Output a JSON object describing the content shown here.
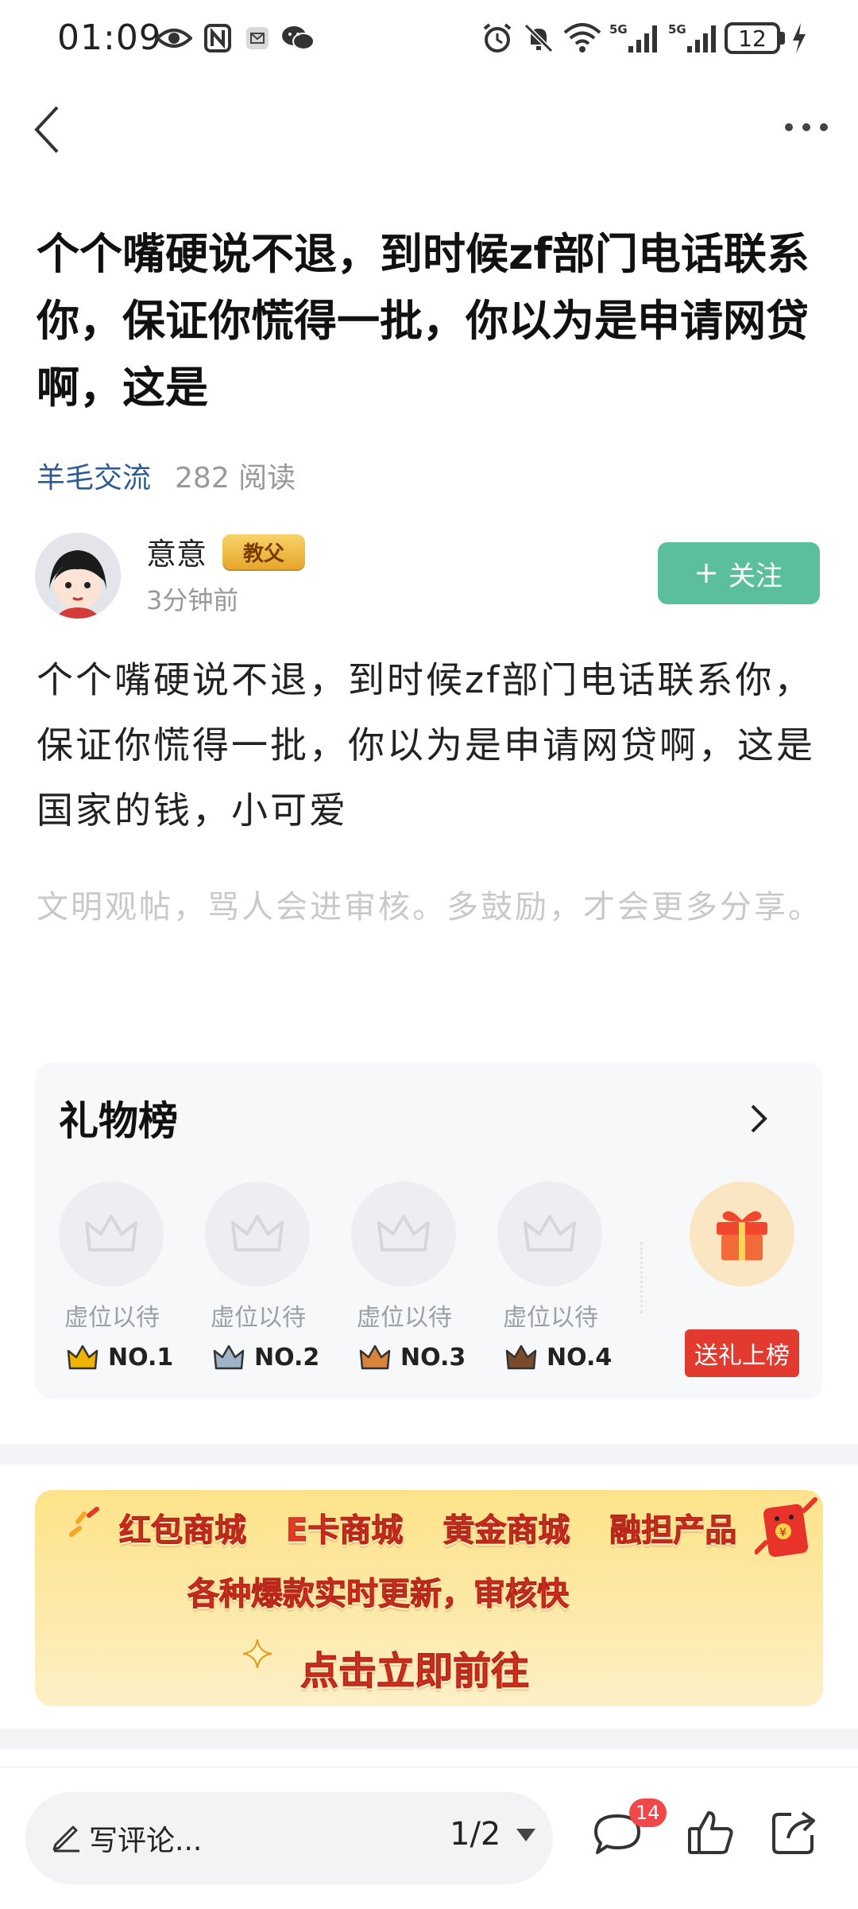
{
  "status_bar": {
    "time": "01:09",
    "battery": "12",
    "icons": [
      "eye-icon",
      "nfc-icon",
      "mail-icon",
      "wechat-icon",
      "alarm-icon",
      "mute-icon",
      "wifi-icon",
      "signal-5g-icon",
      "signal-5g-icon",
      "battery-icon",
      "charging-icon"
    ],
    "network1": "5G",
    "network2": "5G"
  },
  "post": {
    "title": "个个嘴硬说不退，到时候zf部门电话联系你，保证你慌得一批，你以为是申请网贷啊，这是",
    "category": "羊毛交流",
    "read_count": "282 阅读",
    "author": {
      "name": "意意",
      "badge": "教父",
      "time": "3分钟前"
    },
    "follow_label": "关注",
    "body": "个个嘴硬说不退，到时候zf部门电话联系你，保证你慌得一批，你以为是申请网贷啊，这是国家的钱，小可爱",
    "comment_hint": "文明观帖，骂人会进审核。多鼓励，才会更多分享。"
  },
  "gift_board": {
    "title": "礼物榜",
    "slots": [
      {
        "label": "虚位以待",
        "rank": "NO.1",
        "crown_color": "#f0b400"
      },
      {
        "label": "虚位以待",
        "rank": "NO.2",
        "crown_color": "#9fb4c8"
      },
      {
        "label": "虚位以待",
        "rank": "NO.3",
        "crown_color": "#d9843a"
      },
      {
        "label": "虚位以待",
        "rank": "NO.4",
        "crown_color": "#7a4a2a"
      }
    ],
    "send_label": "送礼上榜"
  },
  "promo": {
    "items": [
      "红包商城",
      "E卡商城",
      "黄金商城",
      "融担产品"
    ],
    "subtitle": "各种爆款实时更新，审核快",
    "cta": "点击立即前往"
  },
  "bottom_bar": {
    "comment_placeholder": "写评论...",
    "page_indicator": "1/2",
    "comment_count": "14"
  },
  "colors": {
    "accent_green": "#5bbf9b",
    "link_blue": "#2d5a92",
    "red": "#e23a2e",
    "badge_red": "#f04848"
  }
}
